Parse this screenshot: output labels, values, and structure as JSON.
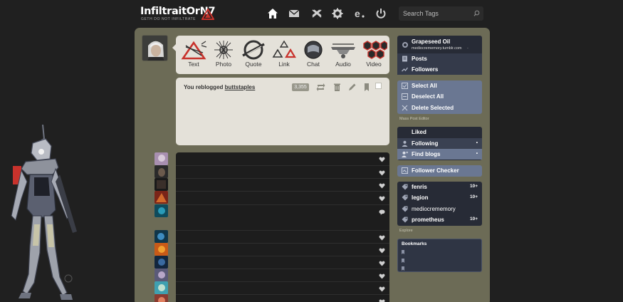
{
  "header": {
    "logo_title": "InfiltraitOrN7",
    "logo_subtitle": "GETH DO NOT INFILTRATE",
    "nav_icons": [
      "home-icon",
      "mail-icon",
      "xkit-icon",
      "gear-icon",
      "e-icon",
      "power-icon"
    ],
    "search_placeholder": "Search Tags"
  },
  "post_types": [
    {
      "label": "Text",
      "icon": "text-icon"
    },
    {
      "label": "Photo",
      "icon": "photo-icon"
    },
    {
      "label": "Quote",
      "icon": "quote-icon"
    },
    {
      "label": "Link",
      "icon": "link-icon"
    },
    {
      "label": "Chat",
      "icon": "chat-icon"
    },
    {
      "label": "Audio",
      "icon": "audio-icon"
    },
    {
      "label": "Video",
      "icon": "video-icon"
    }
  ],
  "notification": {
    "prefix": "You reblogged",
    "blog": "buttstaples",
    "note_count": "3,355"
  },
  "sidebar": {
    "blog_name": "Grapeseed Oil",
    "blog_url": "mediocrememory.tumblr.com",
    "blog_menu": [
      {
        "label": "Posts"
      },
      {
        "label": "Followers"
      }
    ],
    "mass_actions": [
      {
        "label": "Select All"
      },
      {
        "label": "Deselect All"
      },
      {
        "label": "Delete Selected"
      }
    ],
    "mass_note": "Mass Post Editor",
    "social": [
      {
        "label": "Liked"
      },
      {
        "label": "Following"
      },
      {
        "label": "Find blogs"
      }
    ],
    "follower_checker": "Follower Checker",
    "tags": [
      {
        "label": "fenris",
        "count": "10+"
      },
      {
        "label": "legion",
        "count": "10+"
      },
      {
        "label": "mediocrememory",
        "count": ""
      },
      {
        "label": "prometheus",
        "count": "10+"
      }
    ],
    "explore": "Explore",
    "bookmarks_title": "Bookmarks"
  },
  "colors": {
    "background": "#202020",
    "dashboard": "#6c6b56",
    "card": "#e4e1d9",
    "sidebar_dark": "#272b36",
    "sidebar_blue": "#6a7792",
    "accent_red": "#c8322c"
  }
}
